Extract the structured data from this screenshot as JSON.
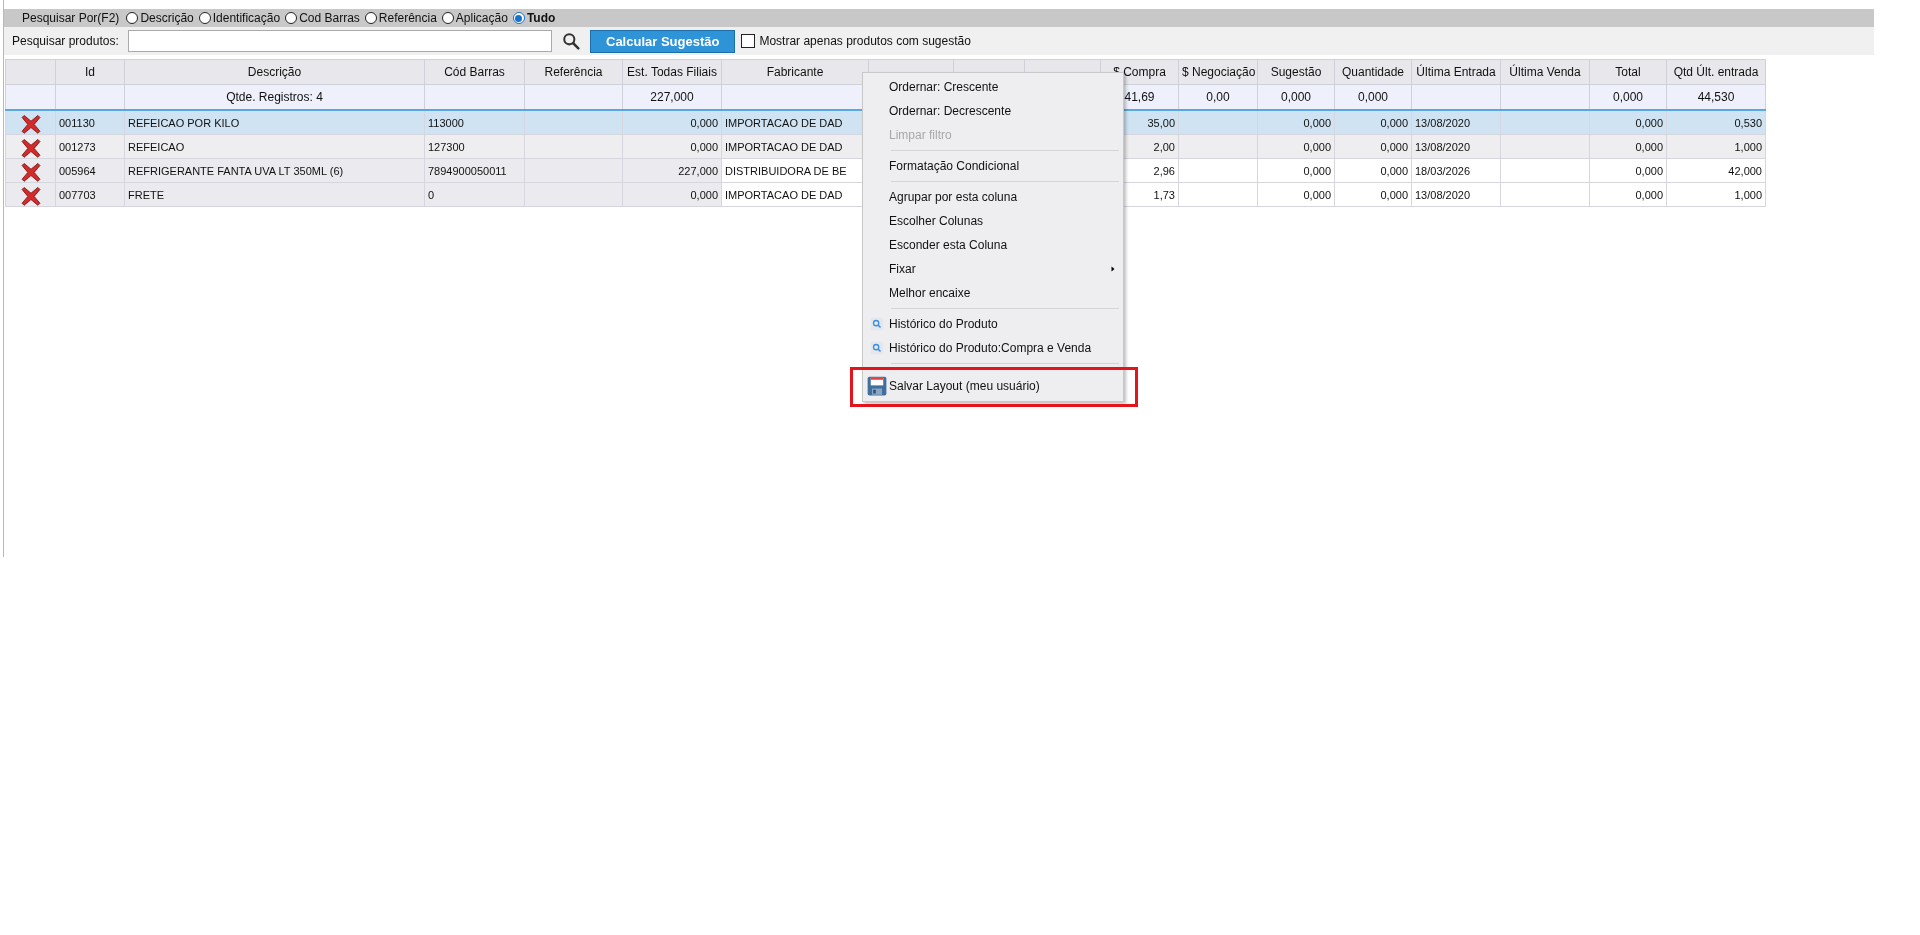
{
  "search_by": {
    "label": "Pesquisar Por(F2)",
    "options": [
      {
        "label": "Descrição",
        "selected": false
      },
      {
        "label": "Identificação",
        "selected": false
      },
      {
        "label": "Cod Barras",
        "selected": false
      },
      {
        "label": "Referência",
        "selected": false
      },
      {
        "label": "Aplicação",
        "selected": false
      },
      {
        "label": "Tudo",
        "selected": true
      }
    ]
  },
  "search": {
    "label": "Pesquisar produtos:",
    "button": "Calcular Sugestão",
    "checkbox": {
      "label": "Mostrar apenas produtos com sugestão",
      "checked": false
    }
  },
  "table": {
    "columns": [
      {
        "kind": "action",
        "locked": true
      },
      {
        "kind": "data",
        "label": "Id",
        "locked": true
      },
      {
        "kind": "data",
        "label": "Descrição",
        "locked": true
      },
      {
        "kind": "data",
        "label": "Cód Barras",
        "locked": true
      },
      {
        "kind": "data",
        "label": "Referência",
        "locked": true
      },
      {
        "kind": "data",
        "label": "Est. Todas Filiais",
        "locked": true
      },
      {
        "kind": "data",
        "label": "Fabricante",
        "locked": false
      },
      {
        "kind": "covered"
      },
      {
        "kind": "covered"
      },
      {
        "kind": "covered"
      },
      {
        "kind": "data",
        "label": "$ Compra",
        "locked": false
      },
      {
        "kind": "data",
        "label": "$ Negociação",
        "locked": false
      },
      {
        "kind": "data",
        "label": "Sugestão",
        "locked": false
      },
      {
        "kind": "data",
        "label": "Quantidade",
        "locked": false
      },
      {
        "kind": "data",
        "label": "Última Entrada",
        "locked": false
      },
      {
        "kind": "data",
        "label": "Última Venda",
        "locked": false
      },
      {
        "kind": "data",
        "label": "Total",
        "locked": false
      },
      {
        "kind": "data",
        "label": "Qtd Últ. entrada",
        "locked": false
      }
    ],
    "summary": {
      "descricao": "Qtde. Registros: 4",
      "est_todas_filiais": "227,000",
      "compra": "41,69",
      "negociacao": "0,00",
      "sugestao": "0,000",
      "quantidade": "0,000",
      "total": "0,000",
      "qtd_ult_entrada": "44,530"
    },
    "rows": [
      {
        "selected": true,
        "shaded": false,
        "id": "001130",
        "descricao": "REFEICAO POR KILO",
        "cod_barras": "113000",
        "est_todas_filiais": "0,000",
        "fabricante": "IMPORTACAO DE DAD",
        "compra": "35,00",
        "sugestao": "0,000",
        "quantidade": "0,000",
        "ultima_entrada": "13/08/2020",
        "total": "0,000",
        "qtd_ult_entrada": "0,530"
      },
      {
        "selected": false,
        "shaded": true,
        "id": "001273",
        "descricao": "REFEICAO",
        "cod_barras": "127300",
        "est_todas_filiais": "0,000",
        "fabricante": "IMPORTACAO DE DAD",
        "compra": "2,00",
        "sugestao": "0,000",
        "quantidade": "0,000",
        "ultima_entrada": "13/08/2020",
        "total": "0,000",
        "qtd_ult_entrada": "1,000"
      },
      {
        "selected": false,
        "shaded": false,
        "id": "005964",
        "descricao": "REFRIGERANTE FANTA UVA LT 350ML (6)",
        "cod_barras": "7894900050011",
        "est_todas_filiais": "227,000",
        "fabricante": "DISTRIBUIDORA DE BE",
        "compra": "2,96",
        "sugestao": "0,000",
        "quantidade": "0,000",
        "ultima_entrada": "18/03/2026",
        "total": "0,000",
        "qtd_ult_entrada": "42,000"
      },
      {
        "selected": false,
        "shaded": false,
        "id": "007703",
        "descricao": "FRETE",
        "cod_barras": "0",
        "est_todas_filiais": "0,000",
        "fabricante": "IMPORTACAO DE DAD",
        "compra": "1,73",
        "sugestao": "0,000",
        "quantidade": "0,000",
        "ultima_entrada": "13/08/2020",
        "total": "0,000",
        "qtd_ult_entrada": "1,000"
      }
    ]
  },
  "context_menu": {
    "items": [
      {
        "kind": "item",
        "label": "Ordernar: Crescente",
        "disabled": false
      },
      {
        "kind": "item",
        "label": "Ordernar: Decrescente",
        "disabled": false
      },
      {
        "kind": "item",
        "label": "Limpar filtro",
        "disabled": true
      },
      {
        "kind": "separator"
      },
      {
        "kind": "item",
        "label": "Formatação Condicional",
        "disabled": false
      },
      {
        "kind": "separator"
      },
      {
        "kind": "item",
        "label": "Agrupar por esta coluna",
        "disabled": false
      },
      {
        "kind": "item",
        "label": "Escolher Colunas",
        "disabled": false
      },
      {
        "kind": "item",
        "label": "Esconder esta Coluna",
        "disabled": false
      },
      {
        "kind": "submenu",
        "label": "Fixar",
        "disabled": false
      },
      {
        "kind": "item",
        "label": "Melhor encaixe",
        "disabled": false
      },
      {
        "kind": "separator"
      },
      {
        "kind": "search",
        "label": "Histórico do Produto",
        "disabled": false
      },
      {
        "kind": "search",
        "label": "Histórico do Produto:Compra e Venda",
        "disabled": false
      },
      {
        "kind": "separator"
      },
      {
        "kind": "save",
        "label": "Salvar Layout (meu usuário)",
        "disabled": false,
        "highlighted": true
      }
    ]
  }
}
